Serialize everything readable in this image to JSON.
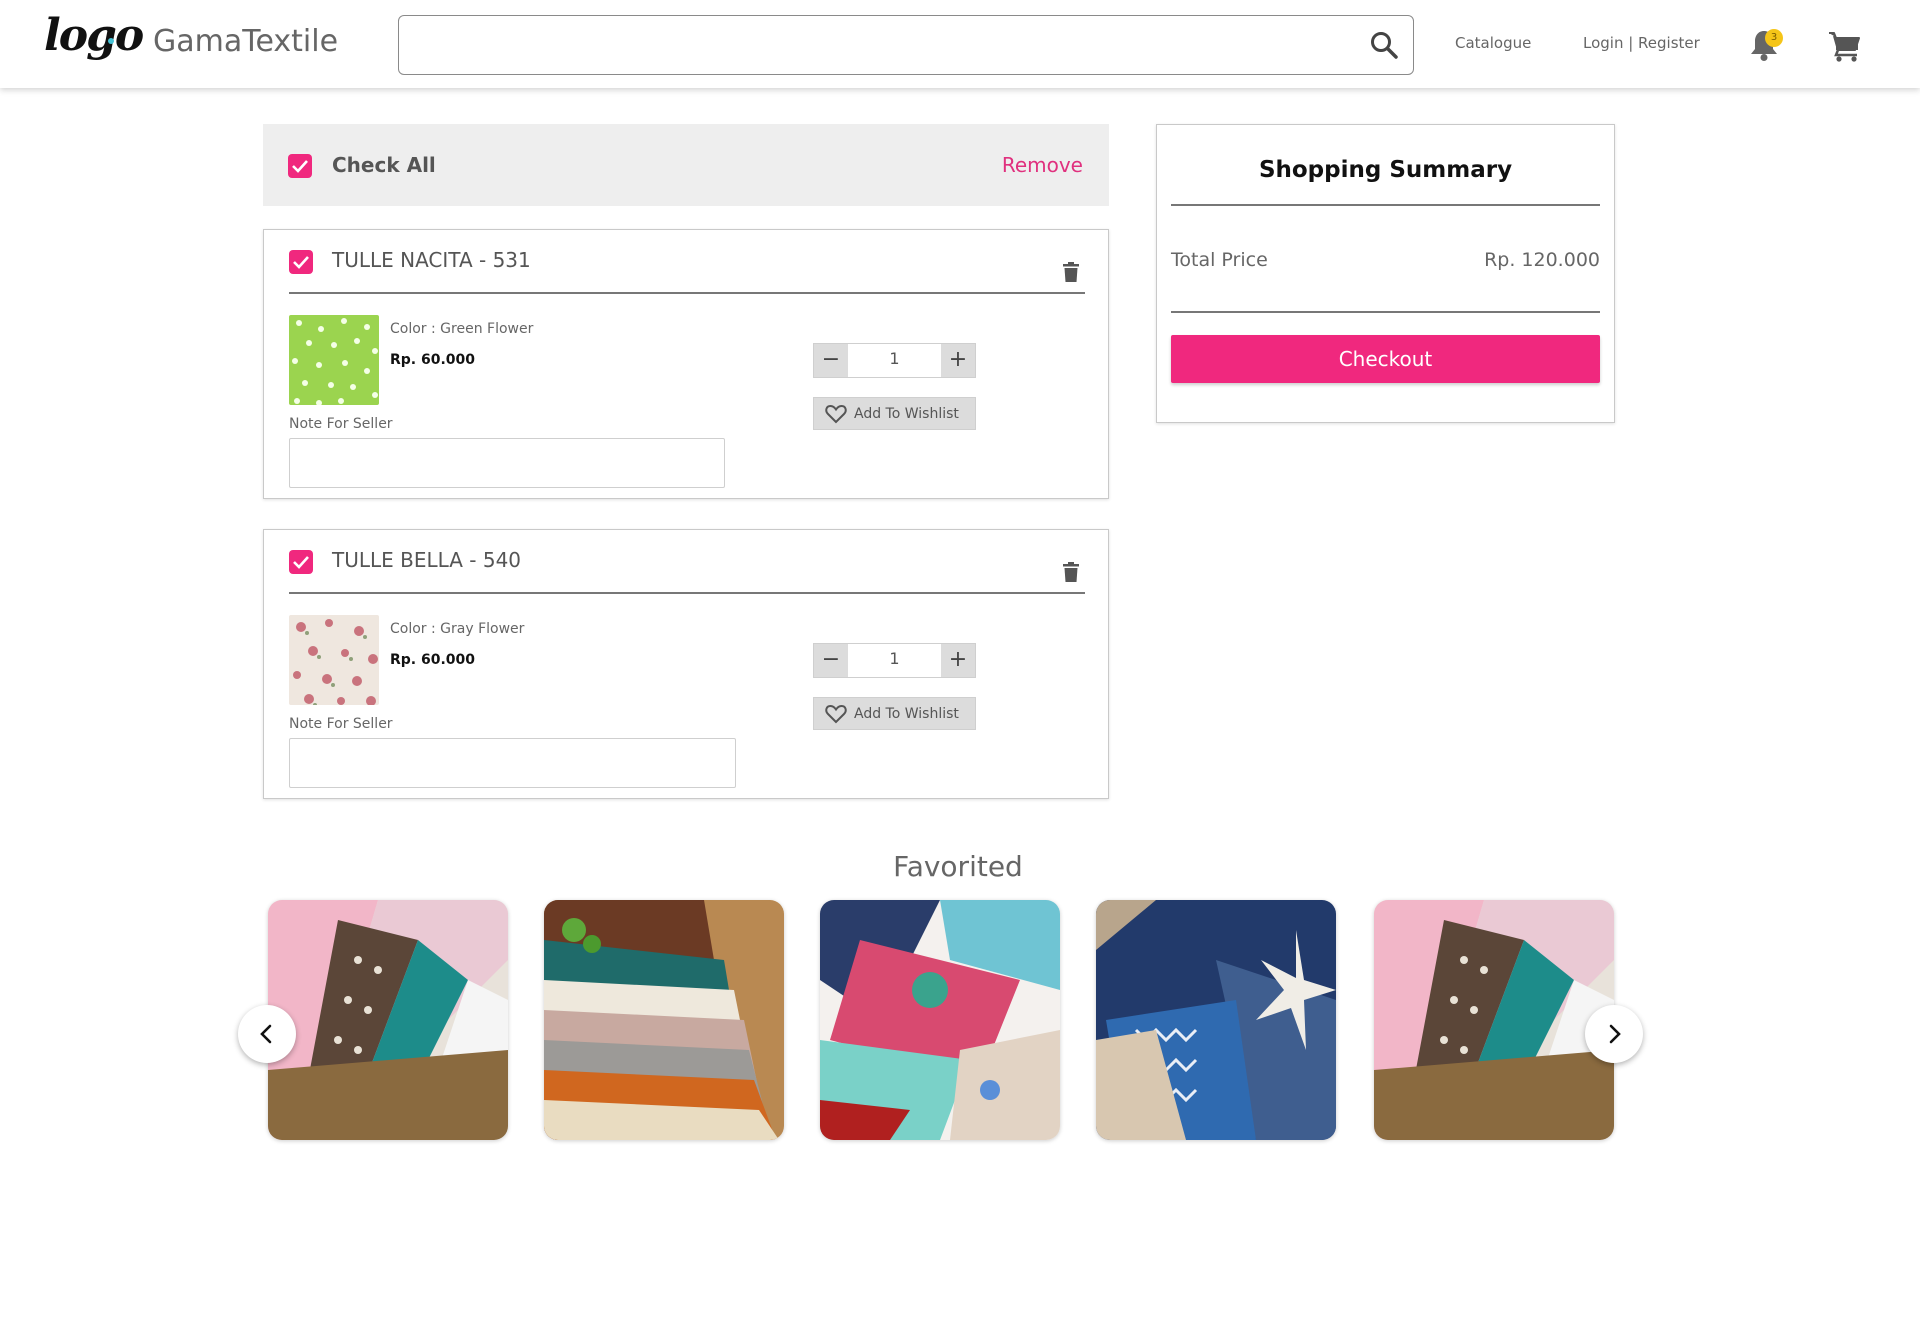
{
  "header": {
    "logo_text": "logo",
    "brand": "GamaTextile",
    "search": {
      "placeholder": ""
    },
    "nav": {
      "catalogue": "Catalogue",
      "login": "Login | Register"
    },
    "notification_count": "3"
  },
  "cart": {
    "check_all_label": "Check All",
    "remove_label": "Remove",
    "items": [
      {
        "title": "TULLE NACITA - 531",
        "color": "Color : Green Flower",
        "price": "Rp. 60.000",
        "note_label": "Note For Seller",
        "quantity": "1",
        "wishlist_label": "Add To Wishlist",
        "checked": true
      },
      {
        "title": "TULLE BELLA - 540",
        "color": "Color : Gray Flower",
        "price": "Rp. 60.000",
        "note_label": "Note For Seller",
        "quantity": "1",
        "wishlist_label": "Add To Wishlist",
        "checked": true
      }
    ]
  },
  "summary": {
    "title": "Shopping Summary",
    "total_label": "Total Price",
    "total_value": "Rp. 120.000",
    "checkout_label": "Checkout"
  },
  "favorited": {
    "title": "Favorited"
  },
  "colors": {
    "accent": "#f0287e",
    "badge": "#f5c518"
  }
}
